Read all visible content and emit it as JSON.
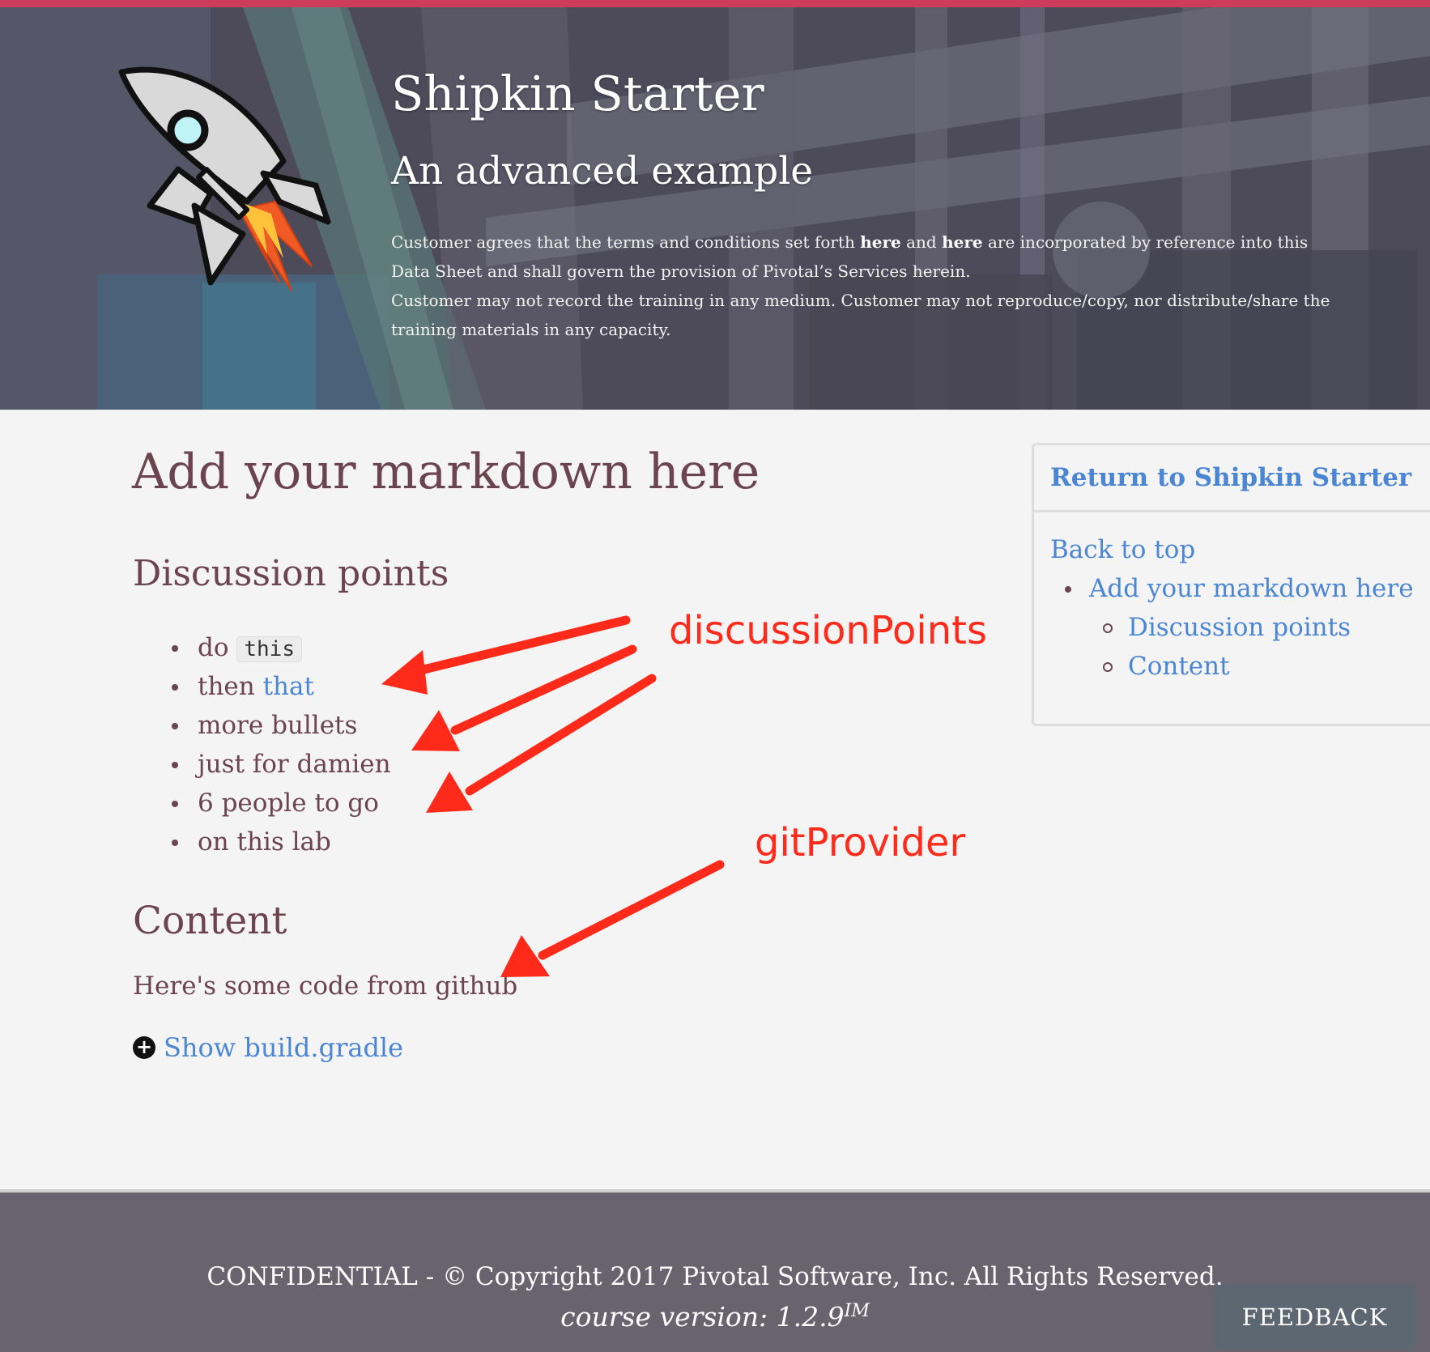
{
  "colors": {
    "accent_stripe": "#cc3d5c",
    "heading": "#6b4450",
    "link": "#4a86d4",
    "annotation": "#ff2a1a",
    "footer_bg": "#67636f",
    "feedback_bg": "#5c6771"
  },
  "header": {
    "title": "Shipkin Starter",
    "subtitle": "An advanced example",
    "terms": {
      "part1": "Customer agrees that the terms and conditions set forth ",
      "link1": "here",
      "part2": " and ",
      "link2": "here",
      "part3": " are incorporated by reference into this Data Sheet and shall govern the provision of Pivotal’s Services herein.",
      "line2": "Customer may not record the training in any medium. Customer may not reproduce/copy, nor distribute/share the training materials in any capacity."
    },
    "logo_icon": "rocket-icon"
  },
  "main": {
    "title": "Add your markdown here",
    "discussion": {
      "heading": "Discussion points",
      "items": [
        {
          "text": "do ",
          "code": "this"
        },
        {
          "text": "then ",
          "link": "that"
        },
        {
          "text": "more bullets"
        },
        {
          "text": "just for damien"
        },
        {
          "text": "6 people to go"
        },
        {
          "text": "on this lab"
        }
      ]
    },
    "content": {
      "heading": "Content",
      "text": "Here's some code from github",
      "toggle_icon": "plus-circle-icon",
      "toggle_glyph": "+",
      "toggle_label": "Show build.gradle"
    }
  },
  "toc": {
    "return_label": "Return to Shipkin Starter",
    "back_to_top": "Back to top",
    "items": [
      {
        "label": "Add your markdown here",
        "children": [
          {
            "label": "Discussion points"
          },
          {
            "label": "Content"
          }
        ]
      }
    ]
  },
  "annotations": {
    "discussion": "discussionPoints",
    "git": "gitProvider"
  },
  "footer": {
    "copyright": "CONFIDENTIAL - © Copyright 2017 Pivotal Software, Inc. All Rights Reserved.",
    "version": "course version: 1.2.9",
    "version_sup": "IM",
    "feedback_label": "FEEDBACK"
  }
}
